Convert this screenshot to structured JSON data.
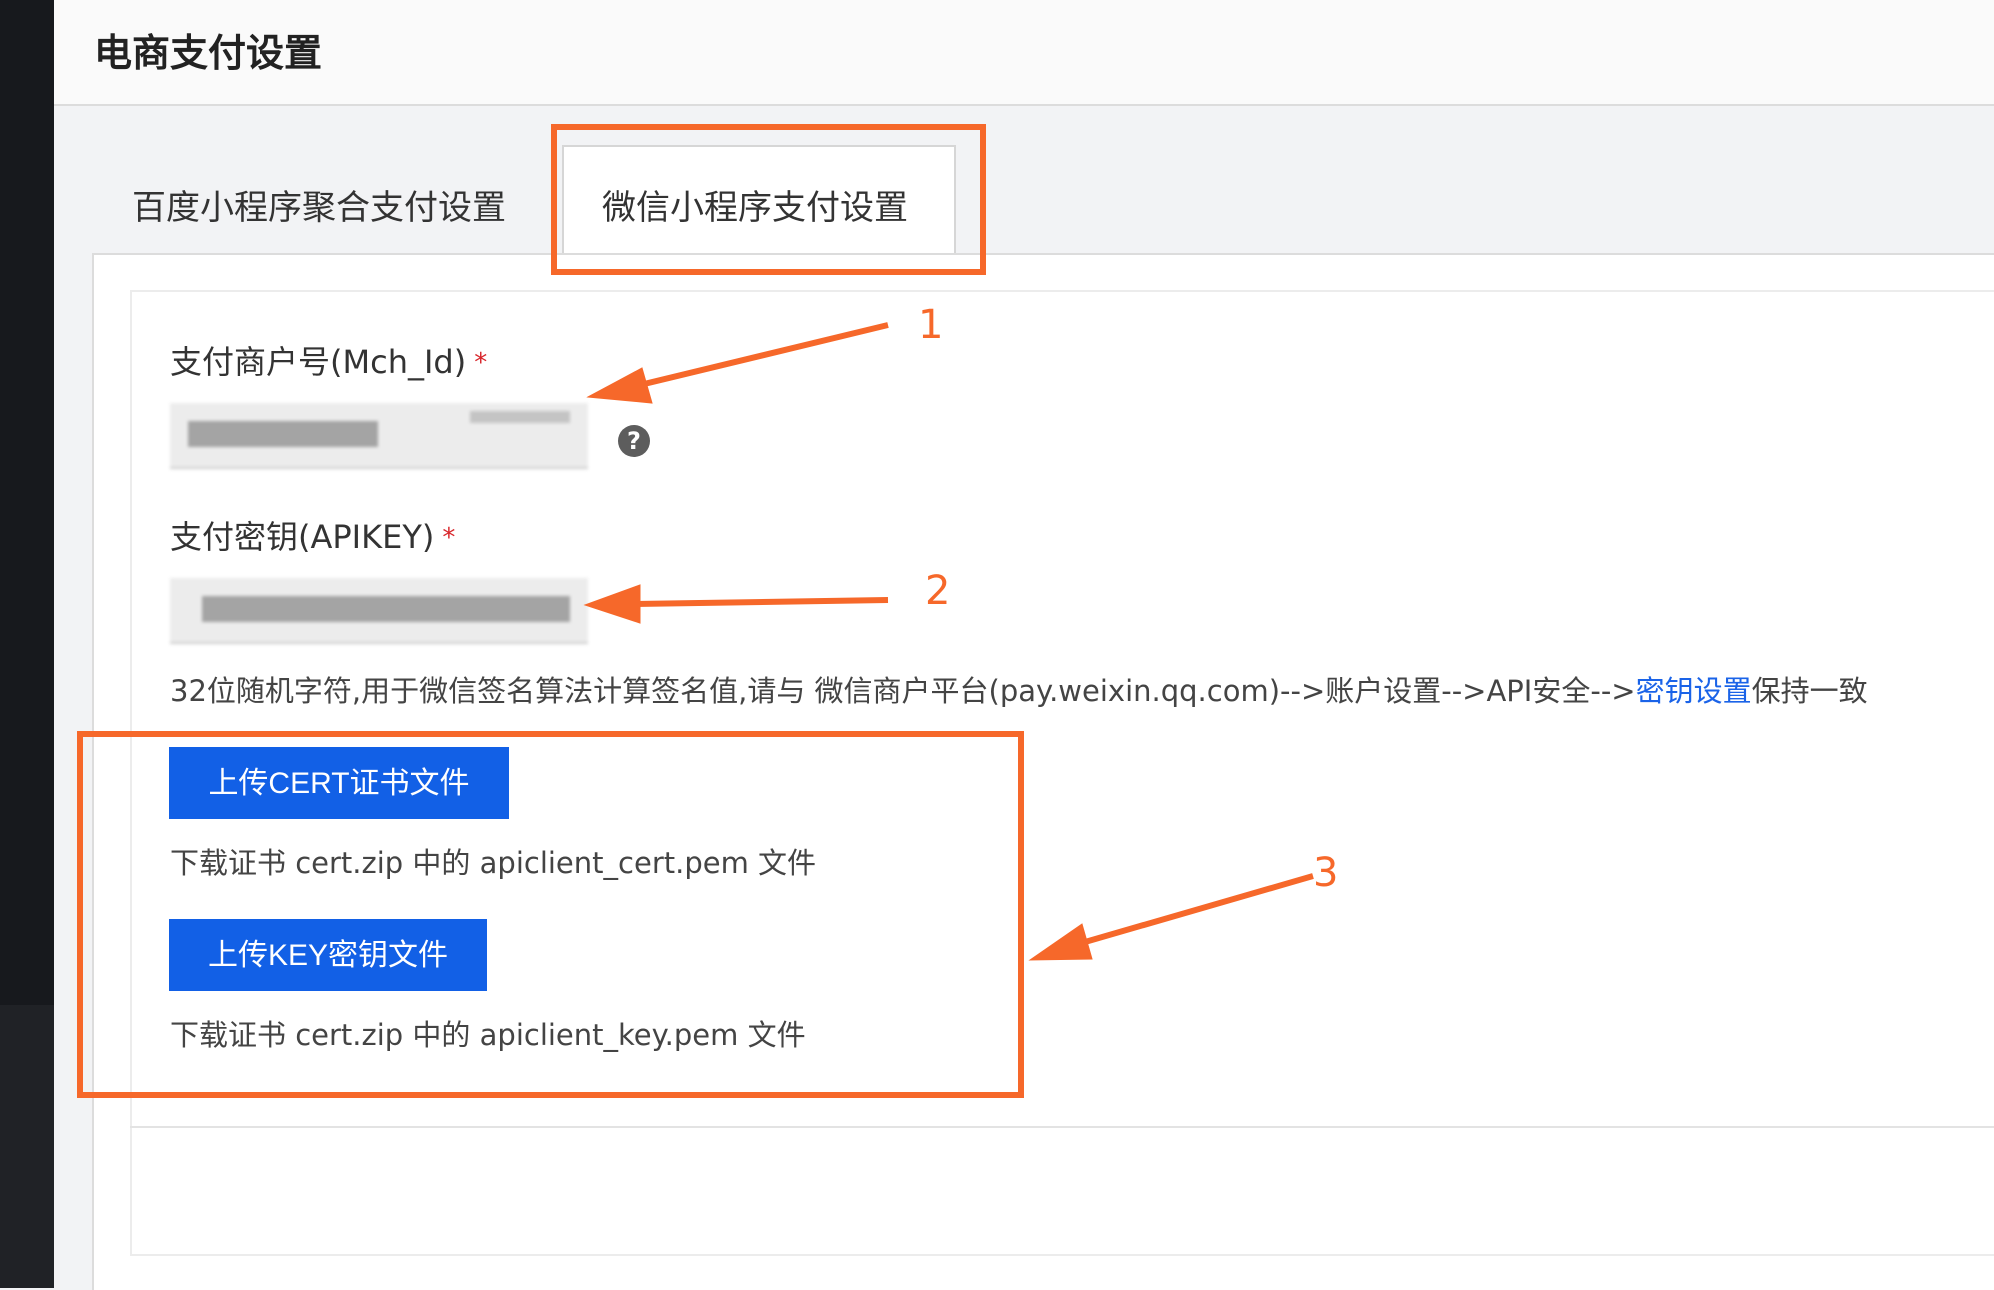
{
  "header": {
    "title": "电商支付设置"
  },
  "tabs": [
    {
      "label": "百度小程序聚合支付设置",
      "active": false
    },
    {
      "label": "微信小程序支付设置",
      "active": true
    }
  ],
  "form": {
    "mch_id": {
      "label": "支付商户号(Mch_Id)",
      "required_mark": "*"
    },
    "apikey": {
      "label": "支付密钥(APIKEY)",
      "required_mark": "*"
    },
    "help_icon": "?",
    "hint_prefix": "32位随机字符,用于微信签名算法计算签名值,请与 微信商户平台(pay.weixin.qq.com)-->账户设置-->API安全-->",
    "hint_link": "密钥设置",
    "hint_suffix": "保持一致"
  },
  "uploads": {
    "cert": {
      "button": "上传CERT证书文件",
      "desc": "下载证书 cert.zip 中的 apiclient_cert.pem 文件"
    },
    "key": {
      "button": "上传KEY密钥文件",
      "desc": "下载证书 cert.zip 中的 apiclient_key.pem 文件"
    }
  },
  "annotations": [
    "1",
    "2",
    "3"
  ],
  "colors": {
    "accent": "#1260e6",
    "annotation": "#f6682a",
    "required": "#d8262b",
    "link": "#1a63e8"
  }
}
